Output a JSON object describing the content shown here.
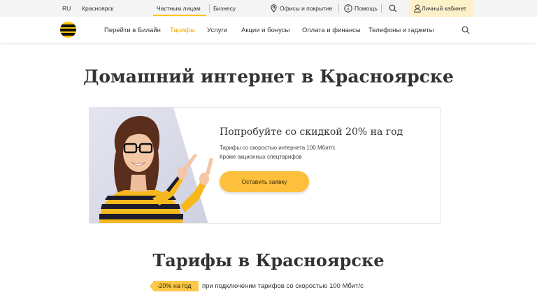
{
  "topbar": {
    "language": "RU",
    "city": "Красноярск",
    "tabs": [
      {
        "label": "Частным лицам",
        "active": true
      },
      {
        "label": "Бизнесу",
        "active": false
      }
    ],
    "offices_label": "Офисы и покрытие",
    "help_label": "Помощь",
    "search_icon": "search-icon",
    "cabinet_label": "Личный кабинет",
    "cabinet_icon": "user-icon"
  },
  "nav": {
    "logo_icon": "beeline-logo",
    "items": [
      {
        "label": "Перейти в Билайн",
        "active": false
      },
      {
        "label": "Тарифы",
        "active": true
      },
      {
        "label": "Услуги",
        "active": false
      },
      {
        "label": "Акции и бонусы",
        "active": false
      },
      {
        "label": "Оплата и финансы",
        "active": false
      },
      {
        "label": "Телефоны и гаджеты",
        "active": false
      }
    ],
    "search_icon": "search-icon"
  },
  "hero": {
    "title": "Домашний интернет в Красноярске"
  },
  "promo": {
    "title": "Попробуйте со скидкой 20% на год",
    "lines": [
      "Тарифы со скоростью интернета 100 Мбит/с",
      "Кроме акционных спецтарифов"
    ],
    "button_label": "Оставить заявку",
    "image": "woman-pointing-photo"
  },
  "tariffs": {
    "title": "Тарифы в Красноярске",
    "badge": "-20% на год",
    "note": "при подключении тарифов со скоростью 100 Мбит/с"
  },
  "colors": {
    "accent": "#fec400",
    "active_nav": "#f0a500",
    "button": "#fdbf3c",
    "topbar_bg": "#f4f4f4",
    "cabinet_bg": "#fdf1c9"
  }
}
